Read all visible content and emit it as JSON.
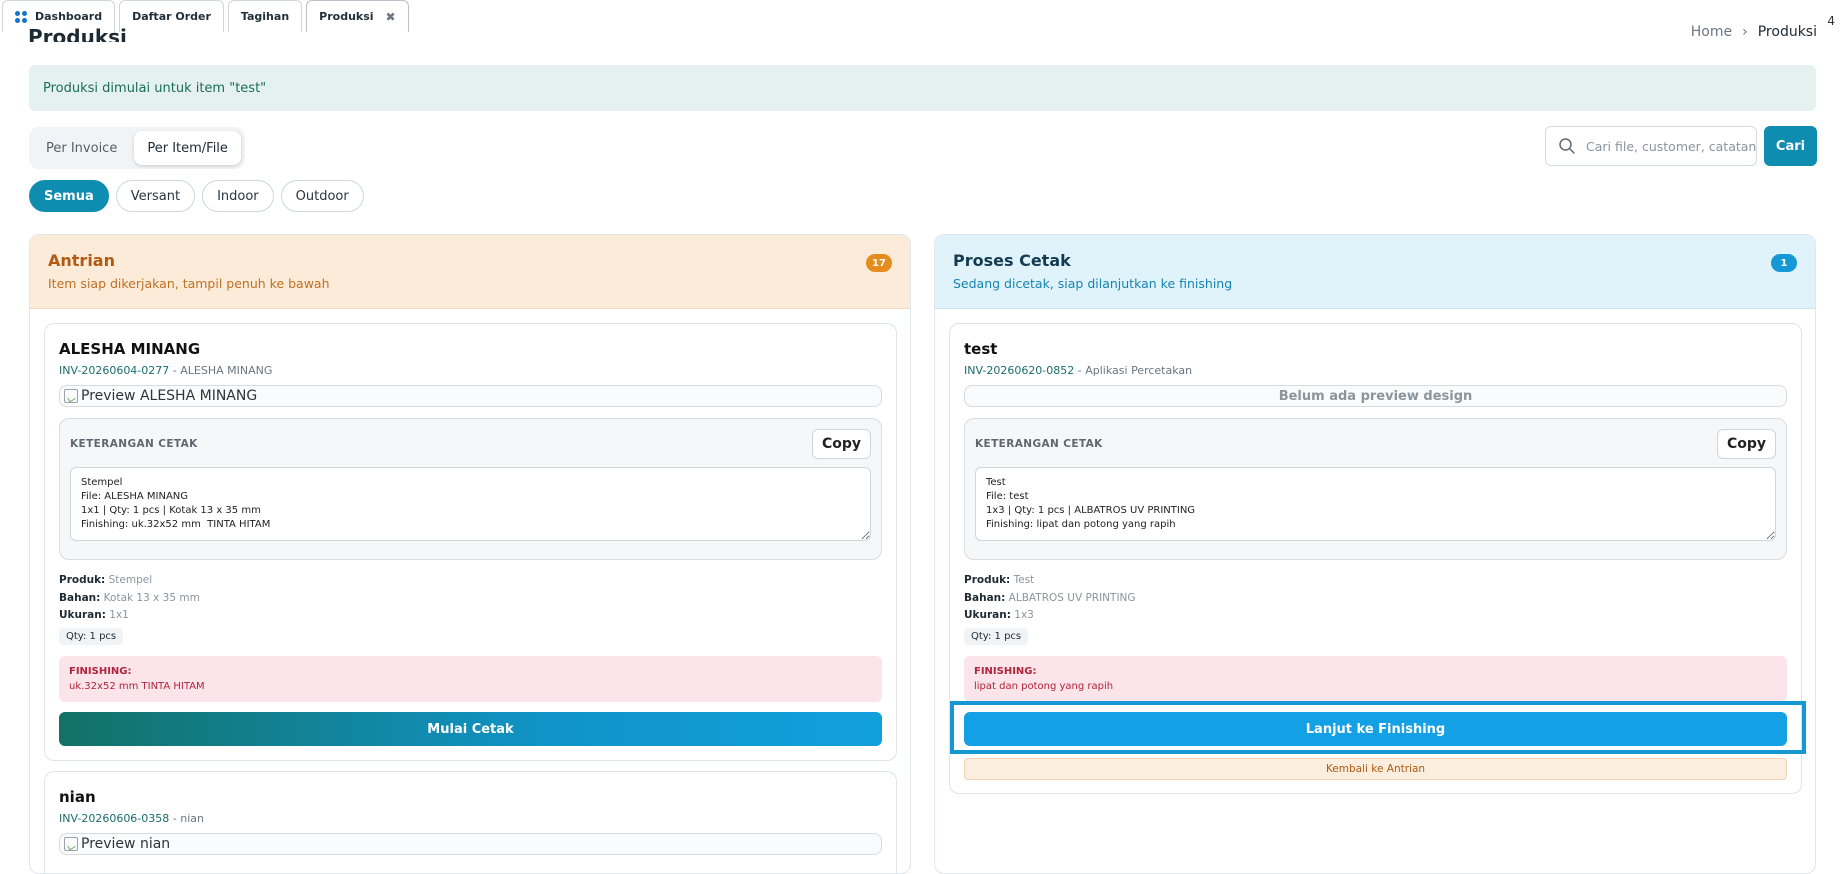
{
  "tabs": [
    {
      "label": "Dashboard",
      "icon": "apps-grid-icon"
    },
    {
      "label": "Daftar Order"
    },
    {
      "label": "Tagihan"
    },
    {
      "label": "Produksi",
      "closable": true
    }
  ],
  "corner_number": "4",
  "page": {
    "title": "Produksi"
  },
  "breadcrumb": {
    "home": "Home",
    "separator": "›",
    "current": "Produksi"
  },
  "alert": {
    "text": "Produksi dimulai untuk item \"test\""
  },
  "view_toggle": {
    "per_invoice": "Per Invoice",
    "per_item": "Per Item/File",
    "active": "Per Item/File"
  },
  "search": {
    "placeholder": "Cari file, customer, catatan...",
    "value": "",
    "button": "Cari"
  },
  "filters": [
    {
      "label": "Semua",
      "active": true
    },
    {
      "label": "Versant"
    },
    {
      "label": "Indoor"
    },
    {
      "label": "Outdoor"
    }
  ],
  "columns": {
    "antrian": {
      "title": "Antrian",
      "subtitle": "Item siap dikerjakan, tampil penuh ke bawah",
      "count": "17",
      "cards": [
        {
          "name": "ALESHA MINANG",
          "invoice": "INV-20260604-0277",
          "customer": "- ALESHA MINANG",
          "preview_alt": "Preview ALESHA MINANG",
          "ket_label": "KETERANGAN CETAK",
          "copy": "Copy",
          "ket_text": "Stempel\nFile: ALESHA MINANG\n1x1 | Qty: 1 pcs | Kotak 13 x 35 mm\nFinishing: uk.32x52 mm  TINTA HITAM",
          "produk_label": "Produk:",
          "produk": "Stempel",
          "bahan_label": "Bahan:",
          "bahan": "Kotak 13 x 35 mm",
          "ukuran_label": "Ukuran:",
          "ukuran": "1x1",
          "qty": "Qty: 1 pcs",
          "finishing_label": "FINISHING:",
          "finishing": "uk.32x52 mm TINTA HITAM",
          "action": "Mulai Cetak"
        },
        {
          "name": "nian",
          "invoice": "INV-20260606-0358",
          "customer": "- nian",
          "preview_alt": "Preview nian"
        }
      ]
    },
    "proses": {
      "title": "Proses Cetak",
      "subtitle": "Sedang dicetak, siap dilanjutkan ke finishing",
      "count": "1",
      "cards": [
        {
          "name": "test",
          "invoice": "INV-20260620-0852",
          "customer": "- Aplikasi Percetakan",
          "preview_empty": "Belum ada preview design",
          "ket_label": "KETERANGAN CETAK",
          "copy": "Copy",
          "ket_text": "Test\nFile: test\n1x3 | Qty: 1 pcs | ALBATROS UV PRINTING\nFinishing: lipat dan potong yang rapih",
          "produk_label": "Produk:",
          "produk": "Test",
          "bahan_label": "Bahan:",
          "bahan": "ALBATROS UV PRINTING",
          "ukuran_label": "Ukuran:",
          "ukuran": "1x3",
          "qty": "Qty: 1 pcs",
          "finishing_label": "FINISHING:",
          "finishing": "lipat dan potong yang rapih",
          "action": "Lanjut ke Finishing",
          "secondary_action": "Kembali ke Antrian"
        }
      ]
    }
  },
  "colors": {
    "primary": "#0f8db0",
    "antrian_bg": "#fcebd9",
    "proses_bg": "#e0f3fb",
    "finishing_bg": "#fbe4ea",
    "highlight": "#1597d1"
  }
}
